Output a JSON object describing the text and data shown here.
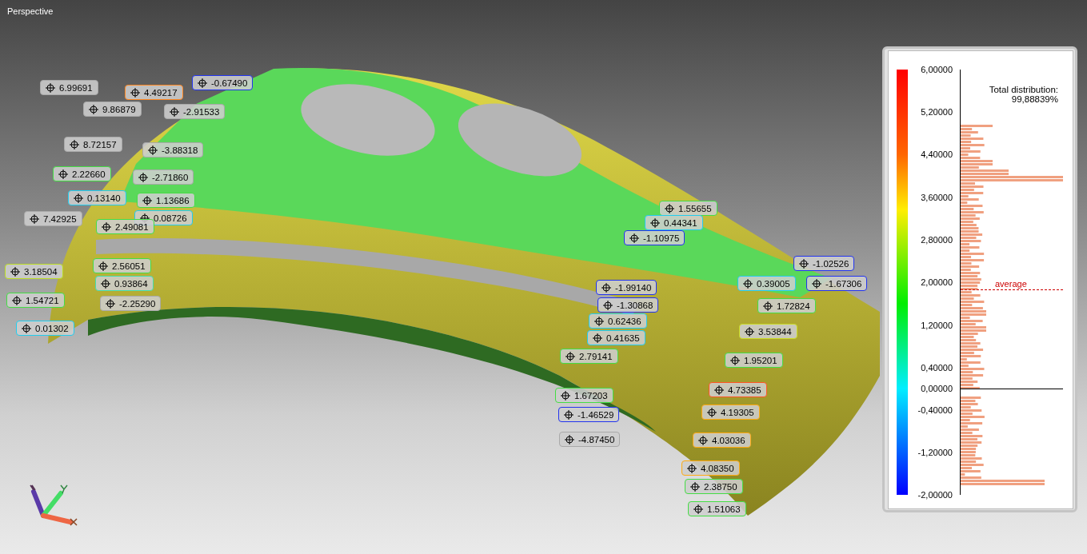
{
  "viewport": {
    "title": "Perspective"
  },
  "annotations": [
    {
      "value": "6.99691",
      "color": "#a9a9a9"
    },
    {
      "value": "-0.67490",
      "color": "#2233ee"
    },
    {
      "value": "4.49217",
      "color": "#ff8822"
    },
    {
      "value": "9.86879",
      "color": "#a9a9a9"
    },
    {
      "value": "-2.91533",
      "color": "#a9a9a9"
    },
    {
      "value": "8.72157",
      "color": "#a9a9a9"
    },
    {
      "value": "-3.88318",
      "color": "#a9a9a9"
    },
    {
      "value": "2.22660",
      "color": "#44dd44"
    },
    {
      "value": "-2.71860",
      "color": "#a9a9a9"
    },
    {
      "value": "1.13686",
      "color": "#44dd44"
    },
    {
      "value": "0.13140",
      "color": "#22ccee"
    },
    {
      "value": "0.08726",
      "color": "#22ccee"
    },
    {
      "value": "7.42925",
      "color": "#a9a9a9"
    },
    {
      "value": "2.49081",
      "color": "#44dd44"
    },
    {
      "value": "2.56051",
      "color": "#44dd44"
    },
    {
      "value": "3.18504",
      "color": "#bbdd22"
    },
    {
      "value": "0.93864",
      "color": "#44ddaa"
    },
    {
      "value": "1.54721",
      "color": "#44dd44"
    },
    {
      "value": "-2.25290",
      "color": "#a9a9a9"
    },
    {
      "value": "0.01302",
      "color": "#22ccee"
    },
    {
      "value": "1.55655",
      "color": "#44dd44"
    },
    {
      "value": "0.44341",
      "color": "#22ccee"
    },
    {
      "value": "-1.10975",
      "color": "#2233ee"
    },
    {
      "value": "-1.99140",
      "color": "#2233ee"
    },
    {
      "value": "-1.30868",
      "color": "#2233ee"
    },
    {
      "value": "0.62436",
      "color": "#22ccee"
    },
    {
      "value": "0.41635",
      "color": "#22ccee"
    },
    {
      "value": "2.79141",
      "color": "#44dd44"
    },
    {
      "value": "1.67203",
      "color": "#44dd44"
    },
    {
      "value": "-1.46529",
      "color": "#2233ee"
    },
    {
      "value": "-4.87450",
      "color": "#a9a9a9"
    },
    {
      "value": "0.39005",
      "color": "#22ccee"
    },
    {
      "value": "-1.02526",
      "color": "#2233ee"
    },
    {
      "value": "-1.67306",
      "color": "#2233ee"
    },
    {
      "value": "1.72824",
      "color": "#44dd44"
    },
    {
      "value": "3.53844",
      "color": "#ccdd22"
    },
    {
      "value": "1.95201",
      "color": "#44dd44"
    },
    {
      "value": "4.73385",
      "color": "#ff5522"
    },
    {
      "value": "4.19305",
      "color": "#ffaa11"
    },
    {
      "value": "4.03036",
      "color": "#ffaa11"
    },
    {
      "value": "4.08350",
      "color": "#ffaa11"
    },
    {
      "value": "2.38750",
      "color": "#44dd44"
    },
    {
      "value": "1.51063",
      "color": "#44dd44"
    }
  ],
  "legend": {
    "ticks": [
      "6,00000",
      "5,20000",
      "4,40000",
      "3,60000",
      "2,80000",
      "2,00000",
      "1,20000",
      "0,40000",
      "0,00000",
      "-0,40000",
      "-1,20000",
      "-2,00000"
    ],
    "total_label": "Total distribution:",
    "total_value": "99,88839%",
    "average_label": "average"
  }
}
